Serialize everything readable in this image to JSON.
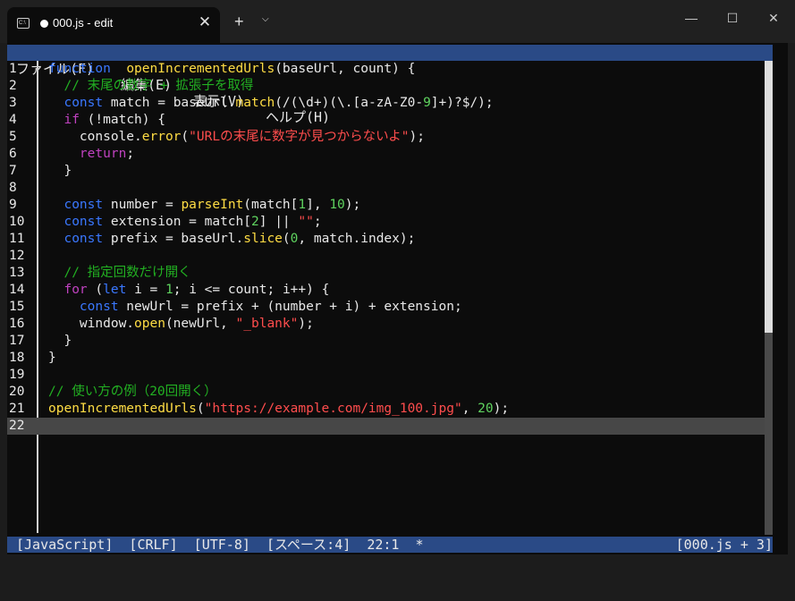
{
  "titlebar": {
    "tab_title": "000.js - edit",
    "app_icon_text": "C:\\",
    "tab_close": "✕",
    "new_tab": "+",
    "dropdown": "⌵",
    "minimize": "—",
    "maximize": "☐",
    "close": "✕"
  },
  "menu": [
    {
      "label": "ファイル(F)"
    },
    {
      "label": "編集(E)"
    },
    {
      "label": "表示(V)"
    },
    {
      "label": "ヘルプ(H)"
    }
  ],
  "editor": {
    "current_line": 22,
    "lines": [
      {
        "n": "1",
        "tokens": [
          [
            "kw",
            "function"
          ],
          [
            "",
            "  "
          ],
          [
            "fn",
            "openIncrementedUrls"
          ],
          [
            "",
            "(baseUrl, count) {"
          ]
        ]
      },
      {
        "n": "2",
        "tokens": [
          [
            "cm",
            "  // 末尾の数字 + 拡張子を取得"
          ]
        ]
      },
      {
        "n": "3",
        "tokens": [
          [
            "",
            "  "
          ],
          [
            "kw",
            "const"
          ],
          [
            "",
            " match = baseUrl."
          ],
          [
            "fn",
            "match"
          ],
          [
            "",
            "(/(\\d+)(\\.[a-zA-Z0-"
          ],
          [
            "num",
            "9"
          ],
          [
            "",
            "]+)?$/);"
          ]
        ]
      },
      {
        "n": "4",
        "tokens": [
          [
            "",
            "  "
          ],
          [
            "ctl",
            "if"
          ],
          [
            "",
            " (!match) {"
          ]
        ]
      },
      {
        "n": "5",
        "tokens": [
          [
            "",
            "    console."
          ],
          [
            "fn",
            "error"
          ],
          [
            "",
            "("
          ],
          [
            "str",
            "\"URLの末尾に数字が見つからないよ\""
          ],
          [
            "",
            ");"
          ]
        ]
      },
      {
        "n": "6",
        "tokens": [
          [
            "",
            "    "
          ],
          [
            "ctl",
            "return"
          ],
          [
            "",
            ";"
          ]
        ]
      },
      {
        "n": "7",
        "tokens": [
          [
            "",
            "  }"
          ]
        ]
      },
      {
        "n": "8",
        "tokens": [
          [
            "",
            ""
          ]
        ]
      },
      {
        "n": "9",
        "tokens": [
          [
            "",
            "  "
          ],
          [
            "kw",
            "const"
          ],
          [
            "",
            " number = "
          ],
          [
            "fn",
            "parseInt"
          ],
          [
            "",
            "(match["
          ],
          [
            "num",
            "1"
          ],
          [
            "",
            "], "
          ],
          [
            "num",
            "10"
          ],
          [
            "",
            ");"
          ]
        ]
      },
      {
        "n": "10",
        "tokens": [
          [
            "",
            "  "
          ],
          [
            "kw",
            "const"
          ],
          [
            "",
            " extension = match["
          ],
          [
            "num",
            "2"
          ],
          [
            "",
            "] || "
          ],
          [
            "str",
            "\"\""
          ],
          [
            "",
            ";"
          ]
        ]
      },
      {
        "n": "11",
        "tokens": [
          [
            "",
            "  "
          ],
          [
            "kw",
            "const"
          ],
          [
            "",
            " prefix = baseUrl."
          ],
          [
            "fn",
            "slice"
          ],
          [
            "",
            "("
          ],
          [
            "num",
            "0"
          ],
          [
            "",
            ", match.index);"
          ]
        ]
      },
      {
        "n": "12",
        "tokens": [
          [
            "",
            ""
          ]
        ]
      },
      {
        "n": "13",
        "tokens": [
          [
            "cm",
            "  // 指定回数だけ開く"
          ]
        ]
      },
      {
        "n": "14",
        "tokens": [
          [
            "",
            "  "
          ],
          [
            "ctl",
            "for"
          ],
          [
            "",
            " ("
          ],
          [
            "kw",
            "let"
          ],
          [
            "",
            " i = "
          ],
          [
            "num",
            "1"
          ],
          [
            "",
            "; i <= count; i++) {"
          ]
        ]
      },
      {
        "n": "15",
        "tokens": [
          [
            "",
            "    "
          ],
          [
            "kw",
            "const"
          ],
          [
            "",
            " newUrl = prefix + (number + i) + extension;"
          ]
        ]
      },
      {
        "n": "16",
        "tokens": [
          [
            "",
            "    window."
          ],
          [
            "fn",
            "open"
          ],
          [
            "",
            "(newUrl, "
          ],
          [
            "str",
            "\"_blank\""
          ],
          [
            "",
            ");"
          ]
        ]
      },
      {
        "n": "17",
        "tokens": [
          [
            "",
            "  }"
          ]
        ]
      },
      {
        "n": "18",
        "tokens": [
          [
            "",
            "}"
          ]
        ]
      },
      {
        "n": "19",
        "tokens": [
          [
            "",
            ""
          ]
        ]
      },
      {
        "n": "20",
        "tokens": [
          [
            "cm",
            "// 使い方の例（20回開く）"
          ]
        ]
      },
      {
        "n": "21",
        "tokens": [
          [
            "fn",
            "openIncrementedUrls"
          ],
          [
            "",
            "("
          ],
          [
            "str",
            "\"https://example.com/img_100.jpg\""
          ],
          [
            "",
            ", "
          ],
          [
            "num",
            "20"
          ],
          [
            "",
            ");"
          ]
        ]
      },
      {
        "n": "22",
        "tokens": [
          [
            "",
            ""
          ]
        ]
      }
    ]
  },
  "status": {
    "left": "[JavaScript]  [CRLF]  [UTF-8]  [スペース:4]  22:1  *",
    "right": "[000.js + 3]"
  },
  "colors": {
    "keyword": "#3a78ff",
    "control": "#c042c0",
    "function": "#ffdd44",
    "string": "#ff4d4d",
    "number": "#5fd35f",
    "comment": "#22b022",
    "bar": "#2a4a86"
  }
}
